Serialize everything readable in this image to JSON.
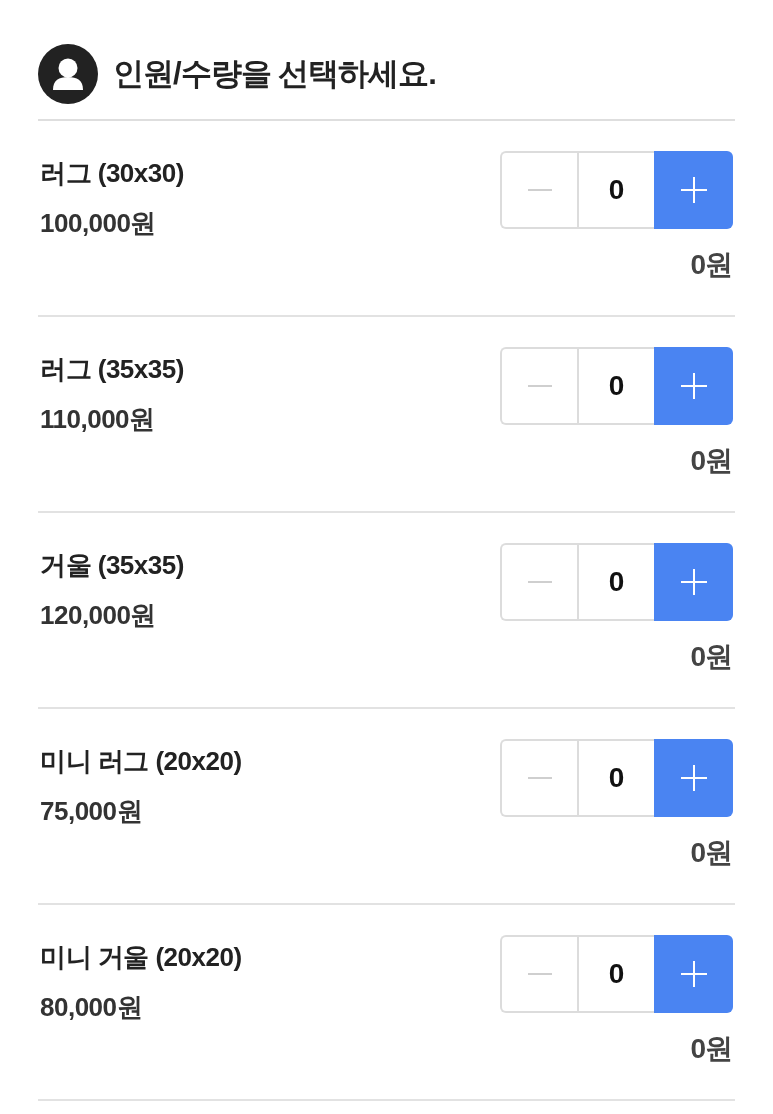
{
  "header": {
    "title": "인원/수량을 선택하세요."
  },
  "items": [
    {
      "name": "러그 (30x30)",
      "price": "100,000원",
      "quantity": "0",
      "minus_disabled": true,
      "subtotal": "0원"
    },
    {
      "name": "러그 (35x35)",
      "price": "110,000원",
      "quantity": "0",
      "minus_disabled": true,
      "subtotal": "0원"
    },
    {
      "name": "거울 (35x35)",
      "price": "120,000원",
      "quantity": "0",
      "minus_disabled": true,
      "subtotal": "0원"
    },
    {
      "name": "미니 러그 (20x20)",
      "price": "75,000원",
      "quantity": "0",
      "minus_disabled": true,
      "subtotal": "0원"
    },
    {
      "name": "미니 거울 (20x20)",
      "price": "80,000원",
      "quantity": "0",
      "minus_disabled": true,
      "subtotal": "0원"
    }
  ]
}
